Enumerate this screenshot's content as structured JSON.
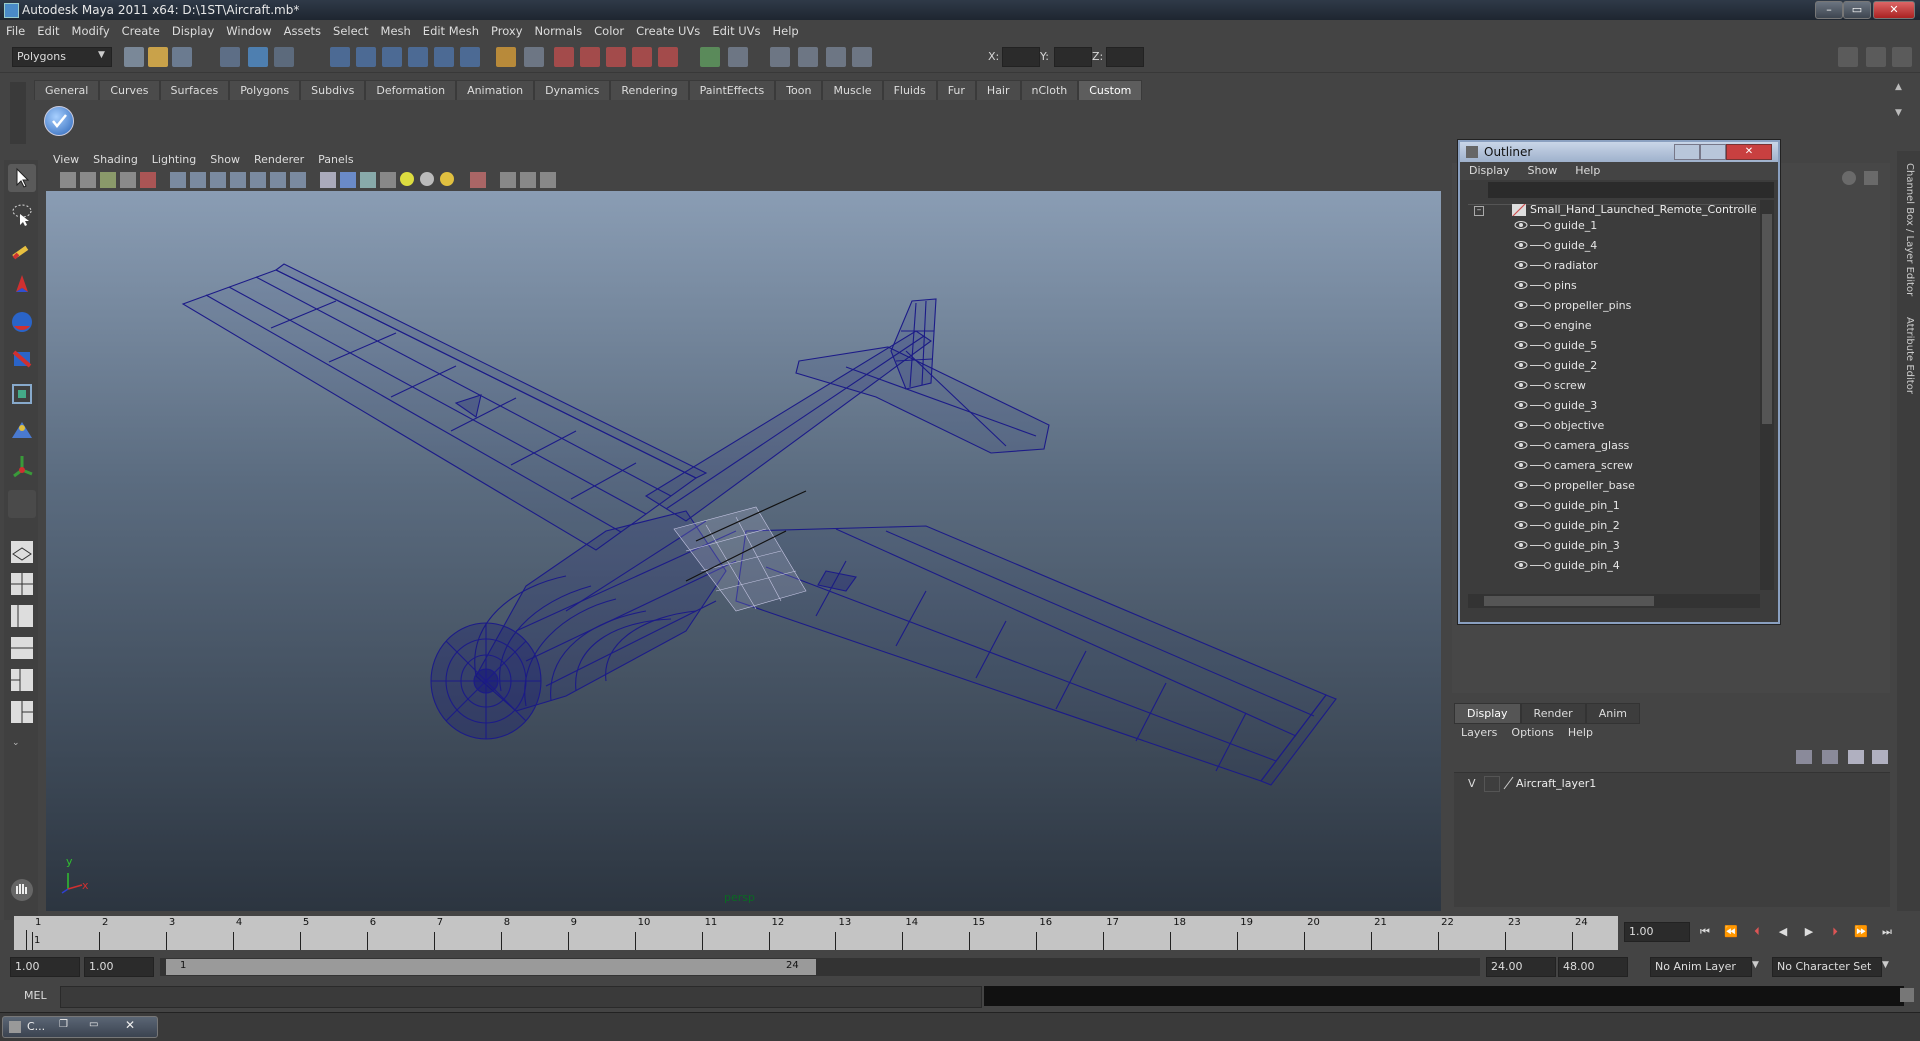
{
  "window": {
    "title": "Autodesk Maya 2011 x64: D:\\1ST\\Aircraft.mb*",
    "btn_min": "–",
    "btn_max": "▭",
    "btn_close": "✕"
  },
  "menubar": [
    "File",
    "Edit",
    "Modify",
    "Create",
    "Display",
    "Window",
    "Assets",
    "Select",
    "Mesh",
    "Edit Mesh",
    "Proxy",
    "Normals",
    "Color",
    "Create UVs",
    "Edit UVs",
    "Help"
  ],
  "statusline": {
    "mode": "Polygons",
    "x_label": "X:",
    "y_label": "Y:",
    "z_label": "Z:"
  },
  "shelf_tabs": [
    "General",
    "Curves",
    "Surfaces",
    "Polygons",
    "Subdivs",
    "Deformation",
    "Animation",
    "Dynamics",
    "Rendering",
    "PaintEffects",
    "Toon",
    "Muscle",
    "Fluids",
    "Fur",
    "Hair",
    "nCloth",
    "Custom"
  ],
  "shelf_active": "Custom",
  "viewport": {
    "menu": [
      "View",
      "Shading",
      "Lighting",
      "Show",
      "Renderer",
      "Panels"
    ],
    "camera_label": "persp",
    "axis_y": "y",
    "axis_x": "x",
    "wire_color": "#1c1b88"
  },
  "outliner": {
    "title": "Outliner",
    "menu": [
      "Display",
      "Show",
      "Help"
    ],
    "root": "Small_Hand_Launched_Remote_Controlled_U",
    "items": [
      "guide_1",
      "guide_4",
      "radiator",
      "pins",
      "propeller_pins",
      "engine",
      "guide_5",
      "guide_2",
      "screw",
      "guide_3",
      "objective",
      "camera_glass",
      "camera_screw",
      "propeller_base",
      "guide_pin_1",
      "guide_pin_2",
      "guide_pin_3",
      "guide_pin_4"
    ]
  },
  "side_tabs": {
    "channel_box": "Channel Box / Layer Editor",
    "attribute_editor": "Attribute Editor"
  },
  "layer_editor": {
    "tabs": [
      "Display",
      "Render",
      "Anim"
    ],
    "active_tab": "Display",
    "menu": [
      "Layers",
      "Options",
      "Help"
    ],
    "layers": [
      {
        "visible": "V",
        "name": "Aircraft_layer1"
      }
    ]
  },
  "timeline": {
    "ticks": [
      "1",
      "2",
      "3",
      "4",
      "5",
      "6",
      "7",
      "8",
      "9",
      "10",
      "11",
      "12",
      "13",
      "14",
      "15",
      "16",
      "17",
      "18",
      "19",
      "20",
      "21",
      "22",
      "23",
      "24"
    ],
    "current_frame_marker": "1",
    "current_time": "1.00"
  },
  "range": {
    "start": "1.00",
    "playback_start": "1.00",
    "range_start_label": "1",
    "range_end_label": "24",
    "playback_end": "24.00",
    "end": "48.00",
    "anim_layer": "No Anim Layer",
    "character_set": "No Character Set"
  },
  "command_line": {
    "label": "MEL"
  },
  "taskbar": {
    "item": "C..."
  }
}
